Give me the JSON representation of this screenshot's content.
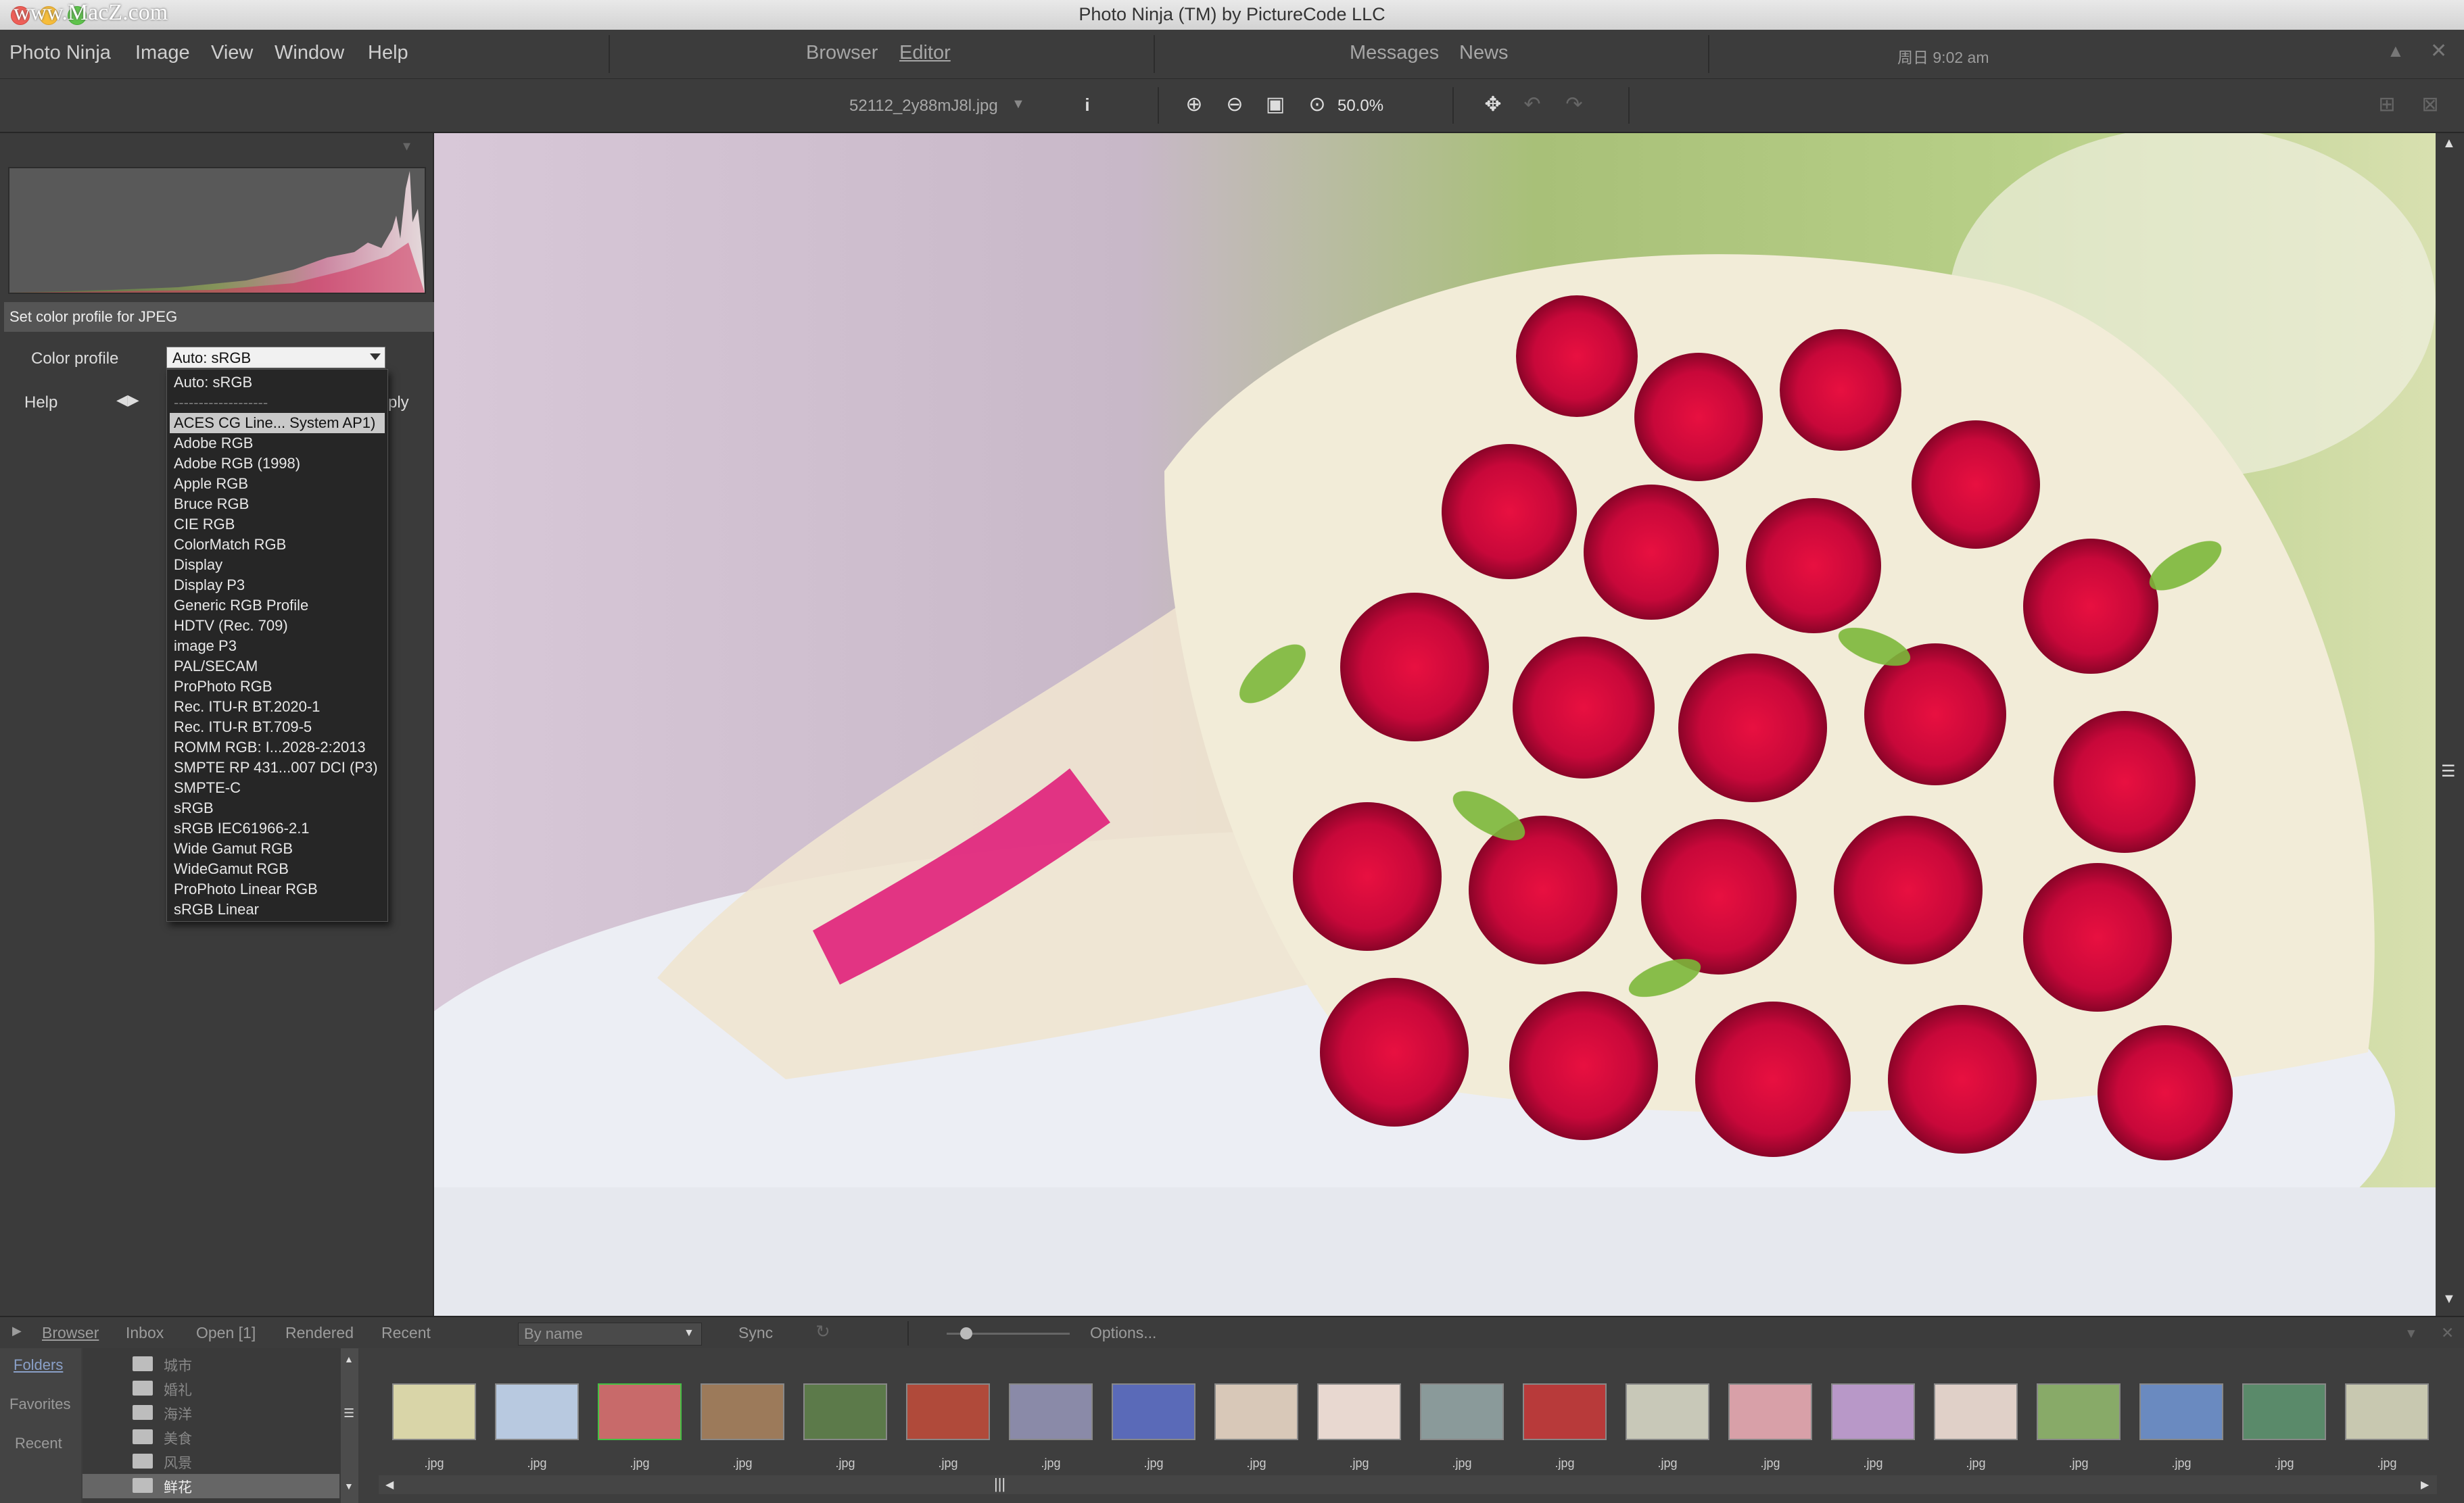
{
  "window": {
    "title": "Photo Ninja (TM) by PictureCode LLC",
    "watermark": "www.MacZ.com"
  },
  "menubar": {
    "items": [
      "Photo Ninja",
      "Image",
      "View",
      "Window",
      "Help"
    ],
    "center_tabs": [
      "Browser",
      "Editor"
    ],
    "active_tab": "Editor",
    "right_tabs": [
      "Messages",
      "News"
    ],
    "clock": "周日 9:02 am"
  },
  "toolbar": {
    "filename": "52112_2y88mJ8l.jpg",
    "info_icon": "info-icon",
    "zoom": "50.0%",
    "icons": [
      "zoom-in-icon",
      "zoom-out-icon",
      "fit-icon",
      "zoom-icon",
      "pan-icon",
      "undo-icon",
      "redo-icon"
    ]
  },
  "left_panel": {
    "section_title": "Set color profile for JPEG",
    "color_profile_label": "Color profile",
    "selected_value": "Auto: sRGB",
    "help_label": "Help",
    "apply_label": "ply",
    "dropdown": {
      "options": [
        "Auto: sRGB",
        "-------------------",
        "ACES CG Line... System AP1)",
        "Adobe RGB",
        "Adobe RGB (1998)",
        "Apple RGB",
        "Bruce RGB",
        "CIE RGB",
        "ColorMatch RGB",
        "Display",
        "Display P3",
        "Generic RGB Profile",
        "HDTV (Rec. 709)",
        "image P3",
        "PAL/SECAM",
        "ProPhoto RGB",
        "Rec. ITU-R BT.2020-1",
        "Rec. ITU-R BT.709-5",
        "ROMM RGB: I...2028-2:2013",
        "SMPTE RP 431...007 DCI (P3)",
        "SMPTE-C",
        "sRGB",
        "sRGB IEC61966-2.1",
        "Wide Gamut RGB",
        "WideGamut RGB",
        "ProPhoto Linear RGB",
        "sRGB Linear"
      ],
      "highlighted": "ACES CG Line... System AP1)"
    }
  },
  "browser": {
    "tabs": [
      "Browser",
      "Inbox",
      "Open [1]",
      "Rendered",
      "Recent"
    ],
    "sort": "By name",
    "sync": "Sync",
    "options": "Options...",
    "side": [
      "Folders",
      "Favorites",
      "Recent"
    ],
    "folders": [
      "城市",
      "婚礼",
      "海洋",
      "美食",
      "风景",
      "鲜花"
    ],
    "selected_folder": "鲜花",
    "thumb_label": ".jpg",
    "thumb_colors": [
      "#d9d5a8",
      "#b8c9e0",
      "#c86a6a",
      "#9c7a5a",
      "#5c7a4a",
      "#b04a3a",
      "#8a8aa8",
      "#5a6ab8",
      "#d8c8b8",
      "#e8d8d0",
      "#8a9a9a",
      "#b83a3a",
      "#c8c8b8",
      "#d8a0a8",
      "#b898c8",
      "#e0d0c8",
      "#88aa68",
      "#6a8ac0",
      "#5a8a6a",
      "#c8c8b0"
    ]
  }
}
